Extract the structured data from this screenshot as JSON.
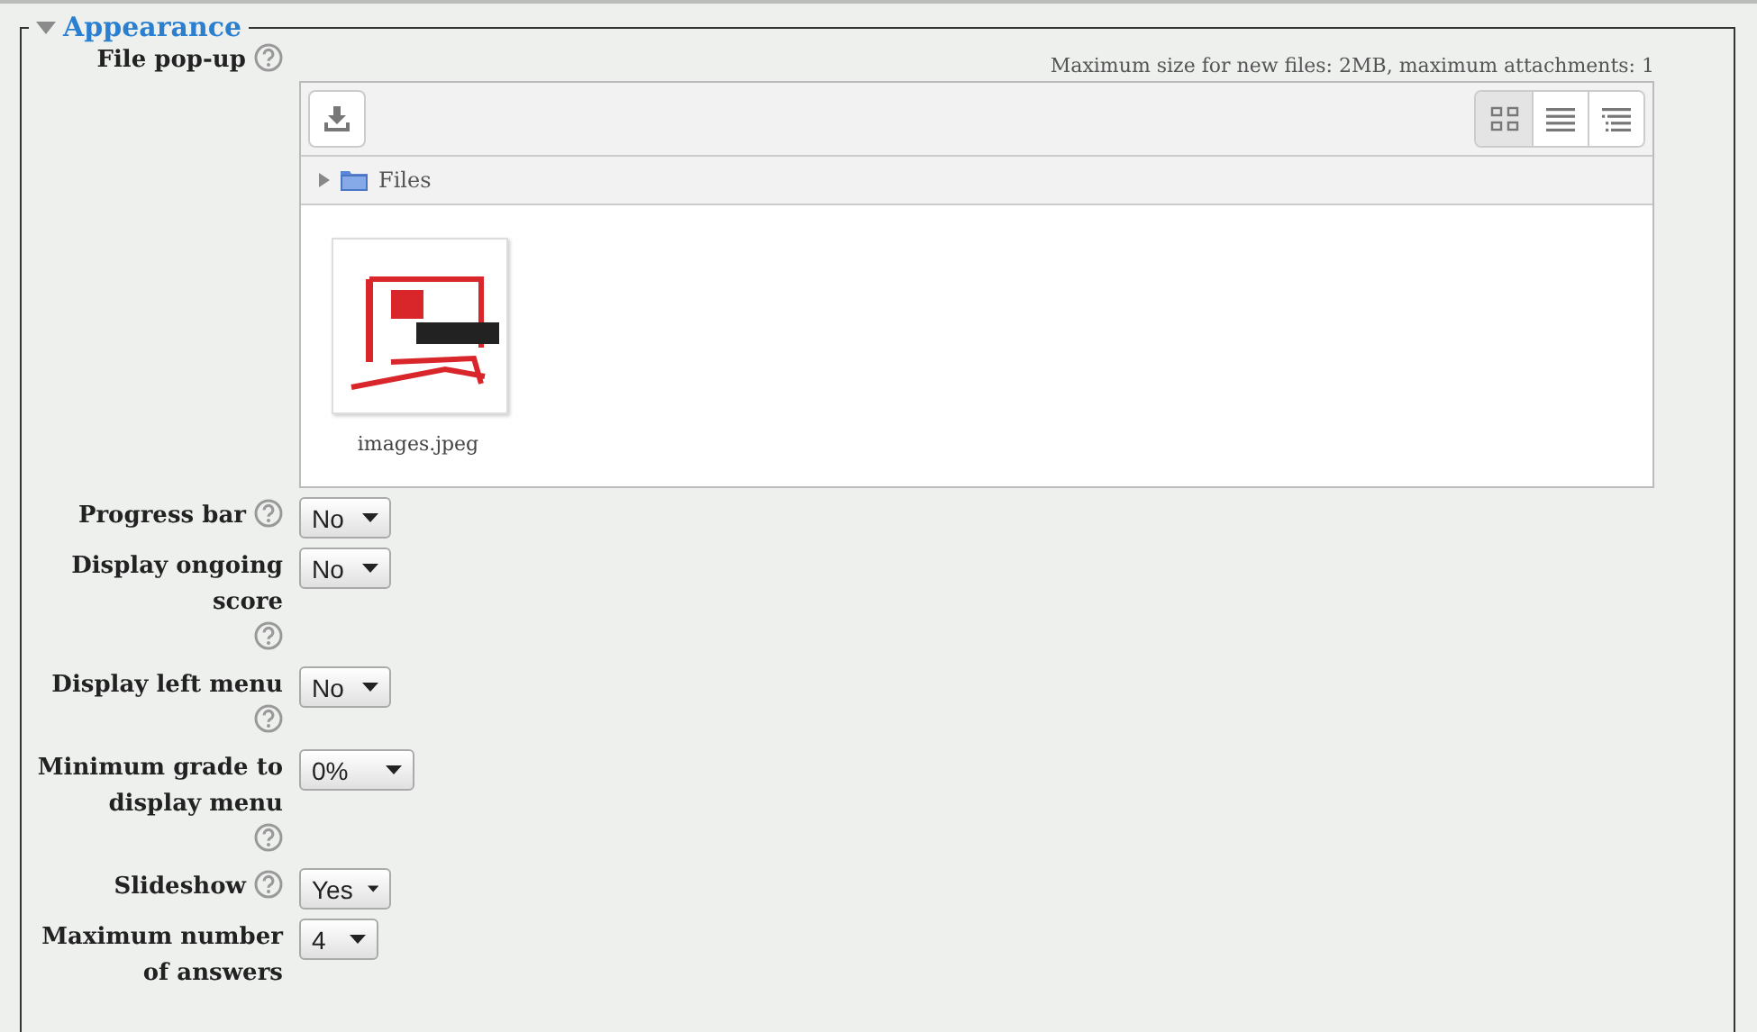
{
  "section": {
    "title": "Appearance",
    "expanded": true
  },
  "file_field": {
    "label": "File pop-up",
    "limits": "Maximum size for new files: 2MB, maximum attachments: 1",
    "views": [
      {
        "kind": "icons",
        "selected": true
      },
      {
        "kind": "list",
        "selected": false
      },
      {
        "kind": "tree",
        "selected": false
      }
    ],
    "path": "Files",
    "files": [
      {
        "name": "images.jpeg"
      }
    ]
  },
  "settings": [
    {
      "label": "Progress bar",
      "value": "No"
    },
    {
      "label": "Display ongoing score",
      "value": "No"
    },
    {
      "label": "Display left menu",
      "value": "No"
    },
    {
      "label": "Minimum grade to display menu",
      "value": "0%"
    },
    {
      "label": "Slideshow",
      "value": "Yes"
    },
    {
      "label": "Maximum number of answers",
      "value": "4"
    }
  ]
}
